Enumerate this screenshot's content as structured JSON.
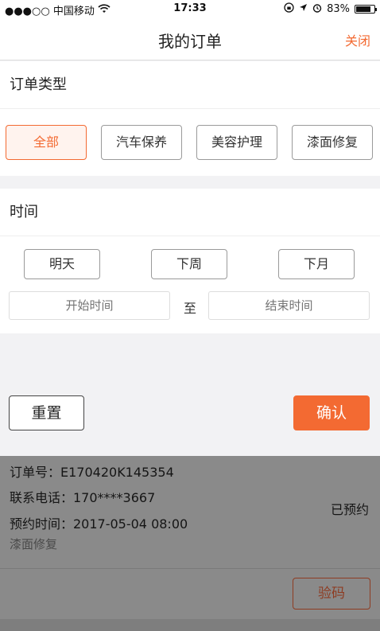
{
  "status_bar": {
    "carrier": "●●●○○ 中国移动",
    "wifi_icon": "wifi-icon",
    "time": "17:33",
    "battery_percent": "83%",
    "battery_level": 0.83
  },
  "nav": {
    "title": "我的订单",
    "close_label": "关闭"
  },
  "order_type": {
    "heading": "订单类型",
    "options": [
      "全部",
      "汽车保养",
      "美容护理",
      "漆面修复"
    ],
    "selected_index": 0
  },
  "time_filter": {
    "heading": "时间",
    "quick_options": [
      "明天",
      "下周",
      "下月"
    ],
    "start_placeholder": "开始时间",
    "to_label": "至",
    "end_placeholder": "结束时间"
  },
  "footer": {
    "reset_label": "重置",
    "confirm_label": "确认"
  },
  "order_card": {
    "order_no": "订单号：E170420K145354",
    "phone": "联系电话：170****3667",
    "appointment": "预约时间：2017-05-04 08:00",
    "service": "漆面修复",
    "status": "已预约",
    "verify_label": "验码"
  },
  "colors": {
    "accent": "#f36a32",
    "overlay": "#8a8a8a"
  }
}
